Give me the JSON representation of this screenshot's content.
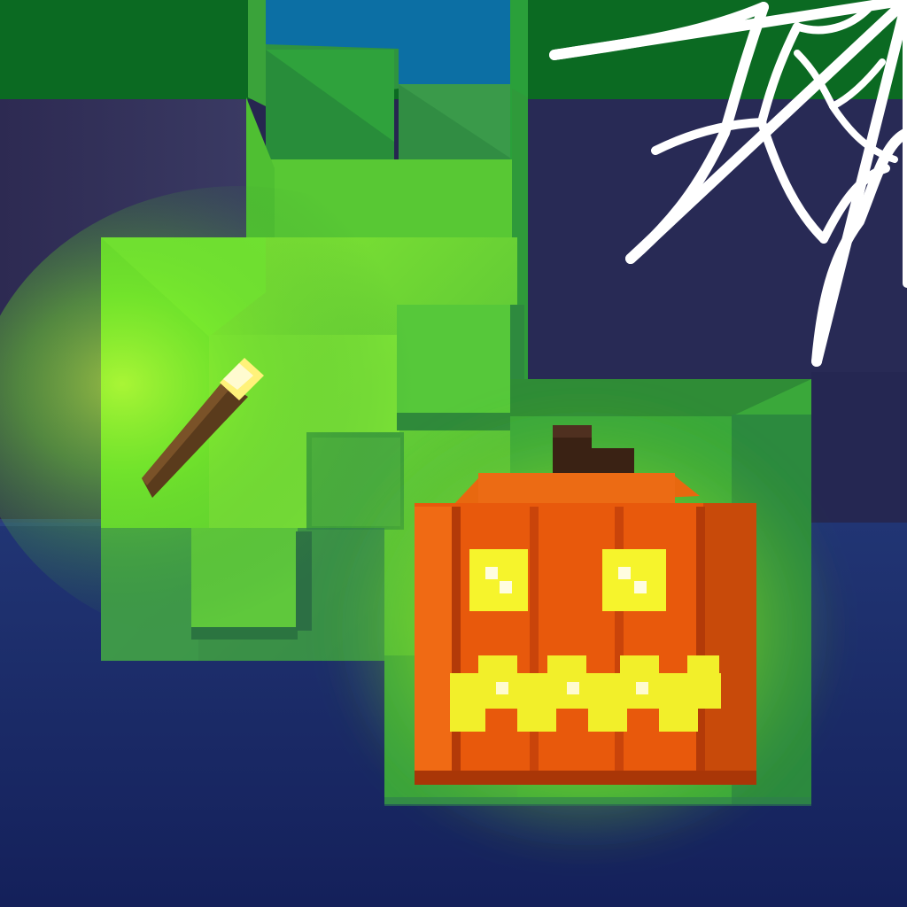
{
  "scene": {
    "name": "halloween-voxel-app-icon",
    "palette": {
      "night_sky": "#232549",
      "deep_water": "#1a2a63",
      "grass_top": "#0a6a21",
      "sky_gap": "#0c6fa4",
      "lit_cave_green": "#74e32a",
      "shadow_green": "#3aa332",
      "pumpkin_orange": "#e8590c",
      "pumpkin_dark": "#b33a08",
      "glow_yellow": "#f6f42c",
      "stem_dark": "#3a2214",
      "torch_handle": "#5a3b1c",
      "torch_flame": "#fff27a",
      "web_white": "#ffffff"
    },
    "icons": [
      {
        "name": "spider-web-icon"
      },
      {
        "name": "jack-o-lantern-icon"
      },
      {
        "name": "torch-icon"
      }
    ]
  }
}
